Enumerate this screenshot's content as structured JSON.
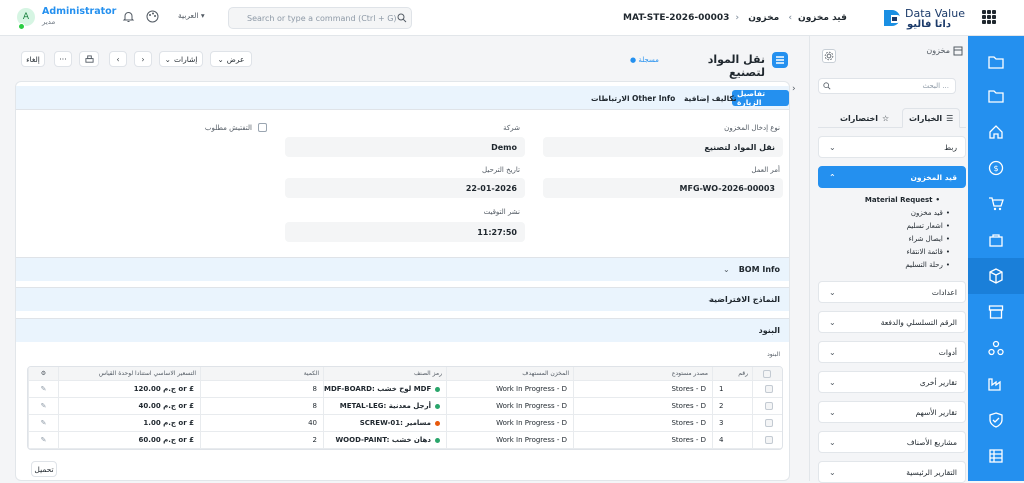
{
  "topbar": {
    "logo_en": "Data Value",
    "logo_ar": "داتا فاليو",
    "breadcrumbs": [
      "مخزون",
      "قيد مخزون",
      "MAT-STE-2026-00003"
    ],
    "search_placeholder": "Search or type a command (Ctrl + G)",
    "language": "العربية",
    "user_name": "Administrator",
    "user_role": "مدير",
    "avatar_letter": "A"
  },
  "sidebar": {
    "title": "مخزون",
    "search_placeholder": "البحث ...",
    "tab_items": "الخيارات",
    "tab_shortcuts": "اختصارات",
    "groups": [
      {
        "label": "ربط"
      },
      {
        "label": "قيد المخزون",
        "active": true
      },
      {
        "label": "اعدادات"
      },
      {
        "label": "الرقم التسلسلي والدفعة"
      },
      {
        "label": "أدوات"
      },
      {
        "label": "تقارير أخرى"
      },
      {
        "label": "تقارير الأسهم"
      },
      {
        "label": "مشاريع الأصناف"
      },
      {
        "label": "التقارير الرئيسية"
      }
    ],
    "sub_items": [
      "Material Request",
      "قيد مخزون",
      "اشعار تسليم",
      "ايصال شراء",
      "قائمة الانتقاء",
      "رحلة التسليم"
    ]
  },
  "page": {
    "title": "نقل المواد لتصنيع",
    "status": "مسجلة",
    "toolbar": {
      "view": "عرض",
      "actions": "إشارات",
      "more": "···",
      "cancel": "إلغاء"
    }
  },
  "tabs": [
    "تفاصيل الزيارة",
    "تكاليف إضافية",
    "Other Info",
    "الارتباطات"
  ],
  "fields": {
    "stock_entry_type_label": "نوع إدخال المخزون",
    "stock_entry_type": "نقل المواد لتصنيع",
    "company_label": "شركة",
    "company": "Demo",
    "inspection_label": "التفتيش مطلوب",
    "work_order_label": "أمر العمل",
    "work_order": "MFG-WO-2026-00003",
    "posting_date_label": "تاريخ الترحيل",
    "posting_date": "22-01-2026",
    "posting_time_label": "نشر التوقيت",
    "posting_time": "11:27:50"
  },
  "sections": {
    "bom": "BOM Info",
    "defaults": "النماذج الافتراضية",
    "items": "البنود",
    "items_sub": "البنود"
  },
  "table": {
    "headers": [
      "رقم",
      "مصدر مستودع",
      "المخزن المستهدف",
      "رمز الصنف",
      "الكمية",
      "التسعير الاساسي استنادا لوحدة القياس"
    ],
    "rows": [
      {
        "no": "1",
        "source": "Stores - D",
        "target": "Work In Progress - D",
        "item": "MDF-BOARD: لوح خشب MDF",
        "dot": "#2aa56b",
        "qty": "8",
        "rate": "ج.م 120.00 or £"
      },
      {
        "no": "2",
        "source": "Stores - D",
        "target": "Work In Progress - D",
        "item": "METAL-LEG: أرجل معدنية",
        "dot": "#2aa56b",
        "qty": "8",
        "rate": "ج.م 40.00 or £"
      },
      {
        "no": "3",
        "source": "Stores - D",
        "target": "Work In Progress - D",
        "item": "SCREW-01: مسامير",
        "dot": "#e8590c",
        "qty": "40",
        "rate": "ج.م 1.00 or £"
      },
      {
        "no": "4",
        "source": "Stores - D",
        "target": "Work In Progress - D",
        "item": "WOOD-PAINT: دهان خشب",
        "dot": "#2aa56b",
        "qty": "2",
        "rate": "ج.م 60.00 or £"
      }
    ],
    "footer_button": "تحميل"
  }
}
